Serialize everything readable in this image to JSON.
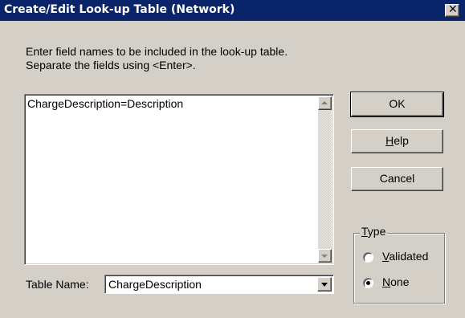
{
  "window": {
    "title": "Create/Edit Look-up Table (Network)",
    "close_glyph": "✕"
  },
  "instructions": {
    "line1": "Enter field names to be included in the look-up table.",
    "line2": "Separate the fields using <Enter>."
  },
  "fields_list": {
    "content": "ChargeDescription=Description"
  },
  "buttons": {
    "ok": "OK",
    "help_mnemonic": "H",
    "help_rest": "elp",
    "cancel": "Cancel"
  },
  "type_group": {
    "legend_mnemonic": "T",
    "legend_rest": "ype",
    "options": [
      {
        "mnemonic": "V",
        "rest": "alidated",
        "selected": false
      },
      {
        "mnemonic": "N",
        "rest": "one",
        "selected": true
      }
    ]
  },
  "table_name": {
    "label": "Table Name:",
    "value": "ChargeDescription"
  }
}
